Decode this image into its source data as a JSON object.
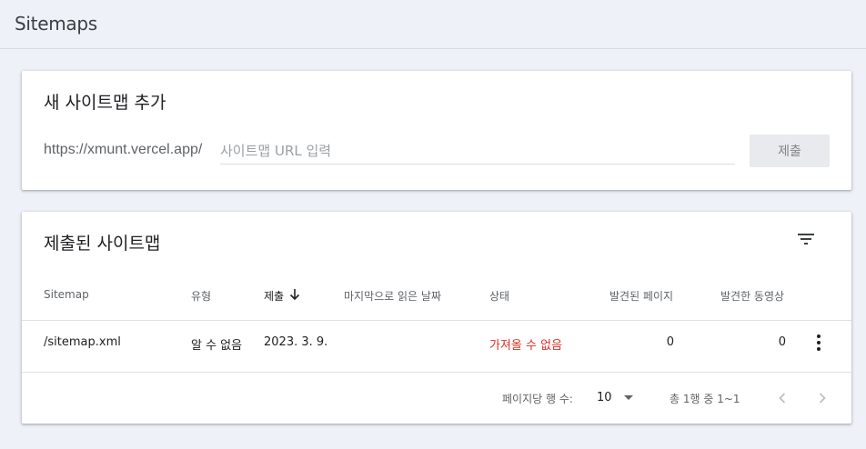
{
  "header": {
    "title": "Sitemaps"
  },
  "add_card": {
    "title": "새 사이트맵 추가",
    "url_prefix": "https://xmunt.vercel.app/",
    "input_placeholder": "사이트맵 URL 입력",
    "input_value": "",
    "submit_label": "제출"
  },
  "list_card": {
    "title": "제출된 사이트맵",
    "filter_icon": "filter-icon",
    "columns": [
      "Sitemap",
      "유형",
      "제출",
      "마지막으로 읽은 날짜",
      "상태",
      "발견된 페이지",
      "발견한 동영상"
    ],
    "sort_column": "제출",
    "sort_direction": "descending",
    "rows": [
      {
        "sitemap": "/sitemap.xml",
        "type": "알 수 없음",
        "submitted": "2023. 3. 9.",
        "last_read": "",
        "status": "가져올 수 없음",
        "pages": "0",
        "videos": "0",
        "menu_icon": "more-vert-icon"
      }
    ],
    "footer": {
      "rows_per_page_label": "페이지당 행 수:",
      "rows_per_page_value": "10",
      "range_text": "총 1행 중 1~1",
      "prev_icon": "chevron-left-icon",
      "next_icon": "chevron-right-icon"
    }
  },
  "colors": {
    "background": "#eef1f8",
    "error": "#d93025",
    "text_secondary": "#5f6368"
  }
}
